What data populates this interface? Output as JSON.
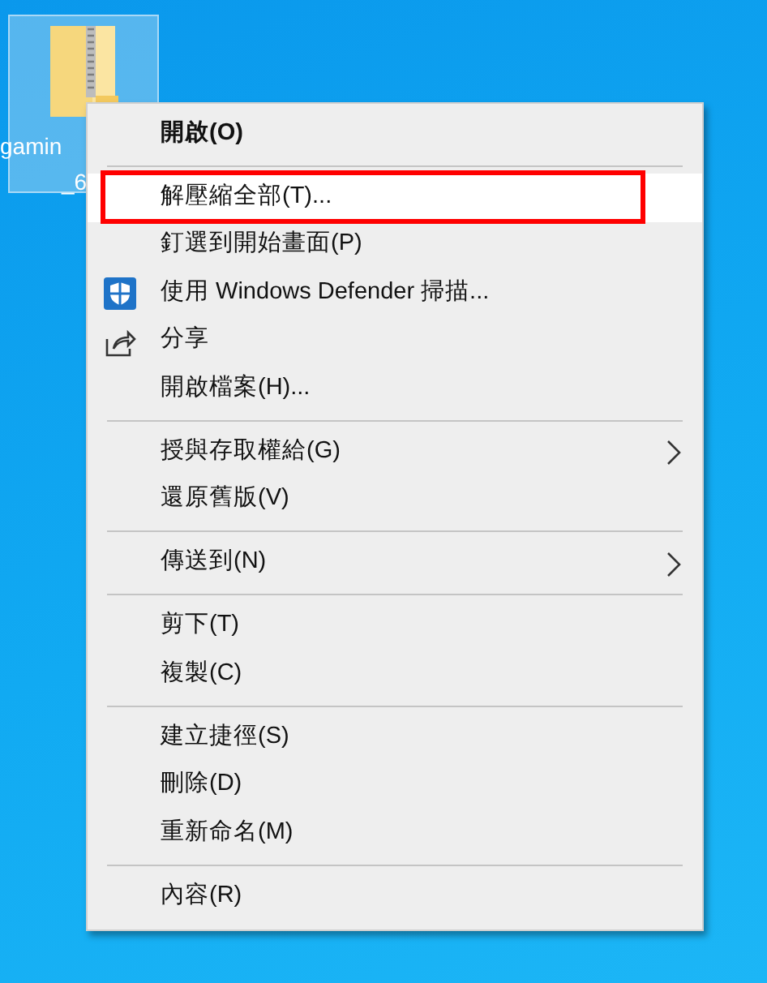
{
  "desktop_icon": {
    "label_lines": [
      "gamin",
      "_6"
    ],
    "selected": true
  },
  "context_menu": {
    "items": [
      {
        "kind": "item",
        "label": "開啟(O)",
        "bold": true,
        "hovered": false,
        "submenu": false
      },
      {
        "kind": "separator"
      },
      {
        "kind": "item",
        "label": "解壓縮全部(T)...",
        "bold": false,
        "hovered": true,
        "submenu": false,
        "outlined": true
      },
      {
        "kind": "item",
        "label": "釘選到開始畫面(P)",
        "bold": false,
        "hovered": false,
        "submenu": false
      },
      {
        "kind": "shield-item",
        "label": "使用 Windows Defender 掃描...",
        "bold": false,
        "hovered": false,
        "submenu": false
      },
      {
        "kind": "share-item",
        "label": "分享",
        "bold": false,
        "hovered": false,
        "submenu": false
      },
      {
        "kind": "item",
        "label": "開啟檔案(H)...",
        "bold": false,
        "hovered": false,
        "submenu": false
      },
      {
        "kind": "separator"
      },
      {
        "kind": "item",
        "label": "授與存取權給(G)",
        "bold": false,
        "hovered": false,
        "submenu": true
      },
      {
        "kind": "item",
        "label": "還原舊版(V)",
        "bold": false,
        "hovered": false,
        "submenu": false
      },
      {
        "kind": "separator"
      },
      {
        "kind": "item",
        "label": "傳送到(N)",
        "bold": false,
        "hovered": false,
        "submenu": true
      },
      {
        "kind": "separator"
      },
      {
        "kind": "item",
        "label": "剪下(T)",
        "bold": false,
        "hovered": false,
        "submenu": false
      },
      {
        "kind": "item",
        "label": "複製(C)",
        "bold": false,
        "hovered": false,
        "submenu": false
      },
      {
        "kind": "separator"
      },
      {
        "kind": "item",
        "label": "建立捷徑(S)",
        "bold": false,
        "hovered": false,
        "submenu": false
      },
      {
        "kind": "item",
        "label": "刪除(D)",
        "bold": false,
        "hovered": false,
        "submenu": false
      },
      {
        "kind": "item",
        "label": "重新命名(M)",
        "bold": false,
        "hovered": false,
        "submenu": false
      },
      {
        "kind": "separator"
      },
      {
        "kind": "item",
        "label": "內容(R)",
        "bold": false,
        "hovered": false,
        "submenu": false
      }
    ]
  }
}
